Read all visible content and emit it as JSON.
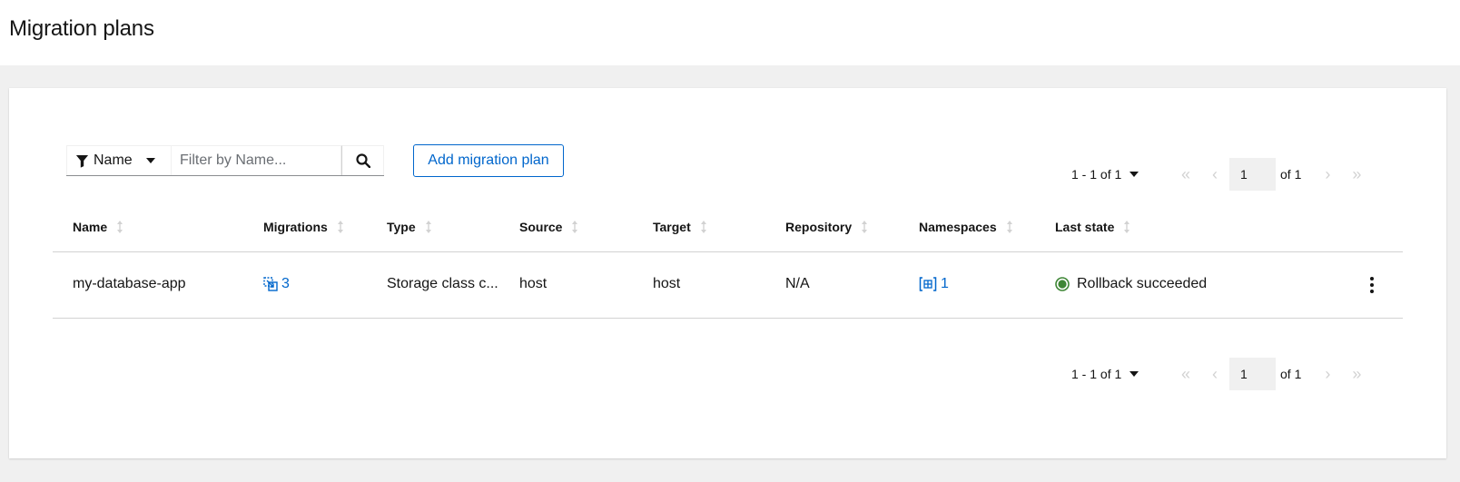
{
  "page": {
    "title": "Migration plans"
  },
  "toolbar": {
    "filter_label": "Name",
    "filter_placeholder": "Filter by Name...",
    "add_button": "Add migration plan"
  },
  "pagination_top": {
    "range": "1 - 1 of 1",
    "page": "1",
    "of": "of 1"
  },
  "pagination_bottom": {
    "range": "1 - 1 of 1",
    "page": "1",
    "of": "of 1"
  },
  "table": {
    "columns": [
      "Name",
      "Migrations",
      "Type",
      "Source",
      "Target",
      "Repository",
      "Namespaces",
      "Last state"
    ],
    "rows": [
      {
        "name": "my-database-app",
        "migrations": "3",
        "type": "Storage class c...",
        "source": "host",
        "target": "host",
        "repository": "N/A",
        "namespaces": "1",
        "last_state": "Rollback succeeded"
      }
    ]
  },
  "icons": {
    "filter": "filter-icon",
    "search": "search-icon",
    "migrations": "migration-icon",
    "namespaces": "namespace-icon",
    "status": "check-circle-icon",
    "kebab": "kebab-icon"
  },
  "colors": {
    "link": "#0066cc",
    "success": "#3e8635",
    "disabled": "#d2d2d2"
  }
}
